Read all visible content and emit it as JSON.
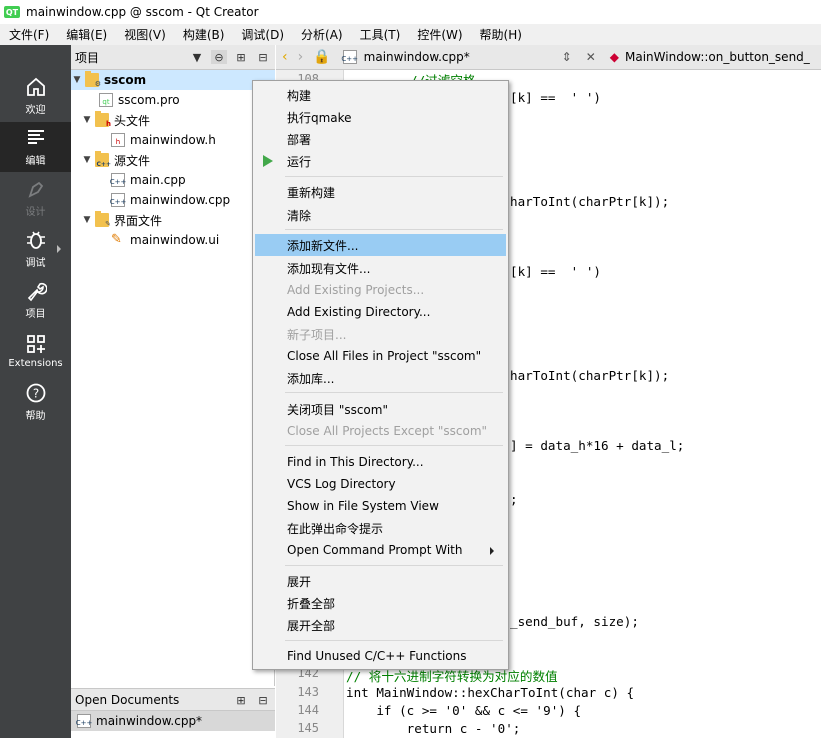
{
  "window": {
    "title": "mainwindow.cpp @ sscom - Qt Creator",
    "logo": "QT"
  },
  "menubar": [
    "文件(F)",
    "编辑(E)",
    "视图(V)",
    "构建(B)",
    "调试(D)",
    "分析(A)",
    "工具(T)",
    "控件(W)",
    "帮助(H)"
  ],
  "modes": [
    {
      "label": "欢迎",
      "icon": "home-icon"
    },
    {
      "label": "编辑",
      "icon": "edit-icon"
    },
    {
      "label": "设计",
      "icon": "design-icon"
    },
    {
      "label": "调试",
      "icon": "debug-icon"
    },
    {
      "label": "项目",
      "icon": "wrench-icon"
    },
    {
      "label": "Extensions",
      "icon": "extensions-icon"
    },
    {
      "label": "帮助",
      "icon": "help-icon"
    }
  ],
  "project_panel": {
    "title": "项目",
    "tree": [
      {
        "label": "sscom",
        "type": "project"
      },
      {
        "label": "sscom.pro",
        "type": "pro"
      },
      {
        "label": "头文件",
        "type": "folder",
        "badge": "h"
      },
      {
        "label": "mainwindow.h",
        "type": "h"
      },
      {
        "label": "源文件",
        "type": "folder",
        "badge": "C++"
      },
      {
        "label": "main.cpp",
        "type": "cpp"
      },
      {
        "label": "mainwindow.cpp",
        "type": "cpp"
      },
      {
        "label": "界面文件",
        "type": "folder",
        "badge": ""
      },
      {
        "label": "mainwindow.ui",
        "type": "ui"
      }
    ]
  },
  "open_documents": {
    "title": "Open Documents",
    "items": [
      "mainwindow.cpp*"
    ]
  },
  "editor": {
    "file_tab": "mainwindow.cpp*",
    "symbol": "MainWindow::on_button_send_",
    "line_numbers": [
      "108",
      "142",
      "143",
      "144",
      "145"
    ],
    "code_lines": [
      "[k] ==  ' ')",
      "harToInt(charPtr[k]);",
      "[k] ==  ' ')",
      "harToInt(charPtr[k]);",
      "] = data_h*16 + data_l;",
      ";",
      "_send_buf, size);",
      "// 将十六进制字符转换为对应的数值",
      "int MainWindow::hexCharToInt(char c) {",
      "    if (c >= '0' && c <= '9') {",
      "        return c - '0';"
    ],
    "top_fragment": "//过滤空格"
  },
  "context_menu": {
    "items": [
      {
        "label": "构建",
        "state": "normal"
      },
      {
        "label": "执行qmake",
        "state": "normal"
      },
      {
        "label": "部署",
        "state": "normal"
      },
      {
        "label": "运行",
        "state": "normal"
      },
      {
        "label": "重新构建",
        "state": "normal"
      },
      {
        "label": "清除",
        "state": "normal"
      },
      {
        "label": "添加新文件...",
        "state": "selected"
      },
      {
        "label": "添加现有文件...",
        "state": "normal"
      },
      {
        "label": "Add Existing Projects...",
        "state": "disabled"
      },
      {
        "label": "Add Existing Directory...",
        "state": "normal"
      },
      {
        "label": "新子项目...",
        "state": "disabled"
      },
      {
        "label": "Close All Files in Project \"sscom\"",
        "state": "normal"
      },
      {
        "label": "添加库...",
        "state": "normal"
      },
      {
        "label": "关闭项目 \"sscom\"",
        "state": "normal"
      },
      {
        "label": "Close All Projects Except \"sscom\"",
        "state": "disabled"
      },
      {
        "label": "Find in This Directory...",
        "state": "normal"
      },
      {
        "label": "VCS Log Directory",
        "state": "normal"
      },
      {
        "label": "Show in File System View",
        "state": "normal"
      },
      {
        "label": "在此弹出命令提示",
        "state": "normal"
      },
      {
        "label": "Open Command Prompt With",
        "state": "normal"
      },
      {
        "label": "展开",
        "state": "normal"
      },
      {
        "label": "折叠全部",
        "state": "normal"
      },
      {
        "label": "展开全部",
        "state": "normal"
      },
      {
        "label": "Find Unused C/C++ Functions",
        "state": "normal"
      }
    ]
  },
  "colors": {
    "selection": "#99ccf3",
    "sidebar": "#404244",
    "run": "#42a84a"
  }
}
